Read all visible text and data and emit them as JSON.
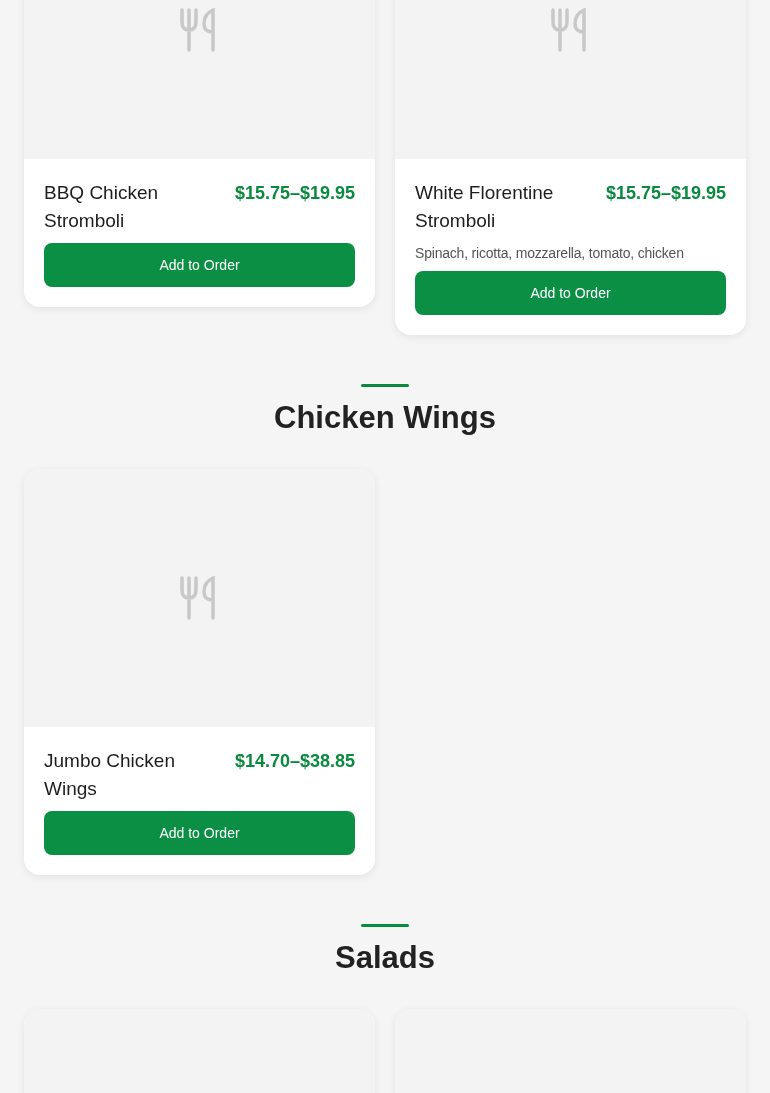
{
  "sections": [
    {
      "items": [
        {
          "kind": "dish",
          "name": "BBQ Chicken Stromboli",
          "price": "$15.75–$19.95",
          "button": "Add to Order"
        },
        {
          "kind": "dish",
          "name": "White Florentine Stromboli",
          "price": "$15.75–$19.95",
          "description": "Spinach, ricotta, mozzarella, tomato, chicken",
          "button": "Add to Order"
        }
      ]
    },
    {
      "title": "Chicken Wings",
      "items": [
        {
          "kind": "dish",
          "name": "Jumbo Chicken Wings",
          "price": "$14.70–$38.85",
          "button": "Add to Order"
        }
      ]
    },
    {
      "title": "Salads",
      "items": [
        {
          "kind": "placeholder"
        },
        {
          "kind": "placeholder"
        }
      ]
    }
  ]
}
